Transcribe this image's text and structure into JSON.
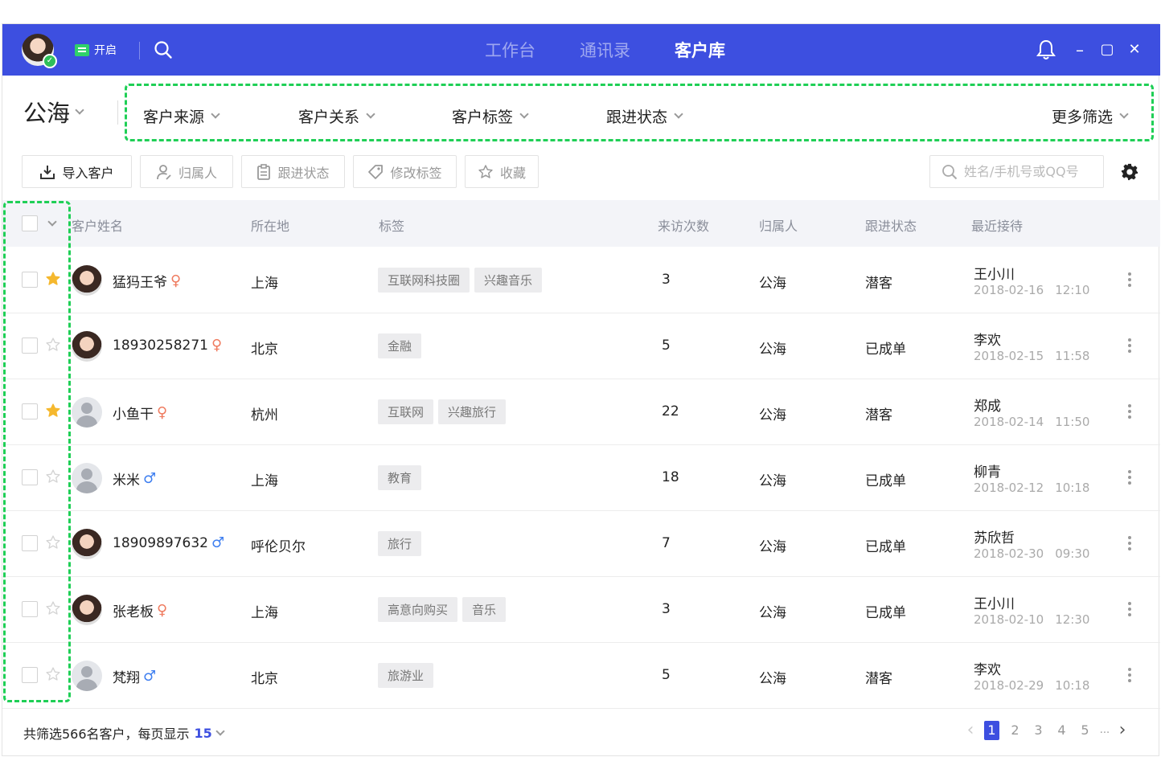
{
  "colors": {
    "brand": "#3d4fe0",
    "highlight_dashed": "#1fcf56",
    "female": "#ef7b5f",
    "male": "#3f7ff0",
    "star_active": "#f5b82e"
  },
  "titlebar": {
    "chat_toggle_label": "开启",
    "tabs": [
      {
        "label": "工作台",
        "active": false
      },
      {
        "label": "通讯录",
        "active": false
      },
      {
        "label": "客户库",
        "active": true
      }
    ],
    "window_controls": {
      "minimize": "–",
      "maximize": "▢",
      "close": "✕"
    }
  },
  "filters": {
    "scope": "公海",
    "items": [
      "客户来源",
      "客户关系",
      "客户标签",
      "跟进状态"
    ],
    "more": "更多筛选"
  },
  "toolbar": {
    "import": "导入客户",
    "owner": "归属人",
    "follow_status": "跟进状态",
    "edit_tags": "修改标签",
    "favorite": "收藏",
    "search_placeholder": "姓名/手机号或QQ号"
  },
  "table": {
    "headers": [
      "客户姓名",
      "所在地",
      "标签",
      "来访次数",
      "归属人",
      "跟进状态",
      "最近接待"
    ],
    "rows": [
      {
        "starred": true,
        "avatar": "photo",
        "name": "猛犸王爷",
        "gender": "female",
        "location": "上海",
        "tags": [
          "互联网科技圈",
          "兴趣音乐"
        ],
        "visits": "3",
        "owner": "公海",
        "status": "潜客",
        "receiver": "王小川",
        "date": "2018-02-16",
        "time": "12:10"
      },
      {
        "starred": false,
        "avatar": "photo",
        "name": "18930258271",
        "gender": "female",
        "location": "北京",
        "tags": [
          "金融"
        ],
        "visits": "5",
        "owner": "公海",
        "status": "已成单",
        "receiver": "李欢",
        "date": "2018-02-15",
        "time": "11:58"
      },
      {
        "starred": true,
        "avatar": "default",
        "name": "小鱼干",
        "gender": "female",
        "location": "杭州",
        "tags": [
          "互联网",
          "兴趣旅行"
        ],
        "visits": "22",
        "owner": "公海",
        "status": "潜客",
        "receiver": "郑成",
        "date": "2018-02-14",
        "time": "11:50"
      },
      {
        "starred": false,
        "avatar": "default",
        "name": "米米",
        "gender": "male",
        "location": "上海",
        "tags": [
          "教育"
        ],
        "visits": "18",
        "owner": "公海",
        "status": "已成单",
        "receiver": "柳青",
        "date": "2018-02-12",
        "time": "10:18"
      },
      {
        "starred": false,
        "avatar": "photo",
        "name": "18909897632",
        "gender": "male",
        "location": "呼伦贝尔",
        "tags": [
          "旅行"
        ],
        "visits": "7",
        "owner": "公海",
        "status": "已成单",
        "receiver": "苏欣哲",
        "date": "2018-02-30",
        "time": "09:30"
      },
      {
        "starred": false,
        "avatar": "photo",
        "name": "张老板",
        "gender": "female",
        "location": "上海",
        "tags": [
          "高意向购买",
          "音乐"
        ],
        "visits": "3",
        "owner": "公海",
        "status": "已成单",
        "receiver": "王小川",
        "date": "2018-02-10",
        "time": "12:30"
      },
      {
        "starred": false,
        "avatar": "default",
        "name": "梵翔",
        "gender": "male",
        "location": "北京",
        "tags": [
          "旅游业"
        ],
        "visits": "5",
        "owner": "公海",
        "status": "潜客",
        "receiver": "李欢",
        "date": "2018-02-29",
        "time": "10:18"
      }
    ]
  },
  "footer": {
    "summary": "共筛选566名客户，每页显示",
    "per_page": "15",
    "pages": [
      "1",
      "2",
      "3",
      "4",
      "5",
      "..."
    ],
    "current_page": "1"
  }
}
